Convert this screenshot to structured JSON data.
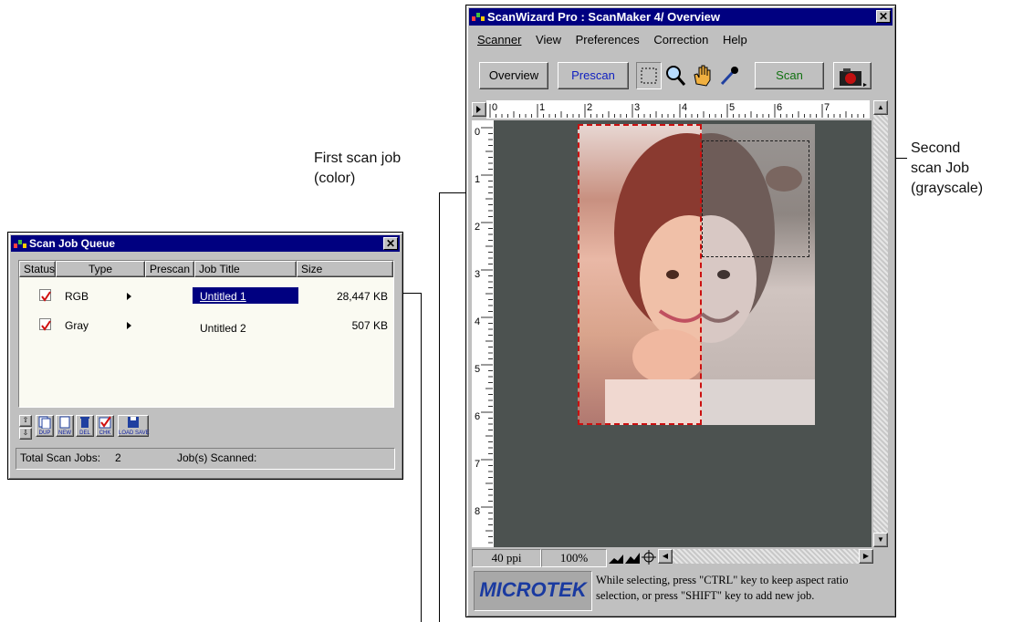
{
  "annotations": {
    "first_line1": "First scan job",
    "first_line2": "(color)",
    "second_line1": "Second",
    "second_line2": "scan Job",
    "second_line3": "(grayscale)"
  },
  "scanwizard": {
    "title": "ScanWizard Pro : ScanMaker 4/ Overview",
    "menu": [
      "Scanner",
      "View",
      "Preferences",
      "Correction",
      "Help"
    ],
    "toolbar": {
      "overview": "Overview",
      "prescan": "Prescan",
      "scan": "Scan"
    },
    "ruler_h_labels": [
      "0",
      "1",
      "2",
      "3",
      "4",
      "5",
      "6",
      "7"
    ],
    "ruler_v_labels": [
      "0",
      "1",
      "2",
      "3",
      "4",
      "5",
      "6",
      "7",
      "8"
    ],
    "resolution": "40 ppi",
    "zoom": "100%",
    "brand": "MICROTEK",
    "hint": "While selecting, press \"CTRL\" key to keep aspect ratio selection, or press \"SHIFT\" key to add new job.",
    "colors": {
      "preview_bg": "#4c5250",
      "selection": "#cc1010"
    }
  },
  "queue": {
    "title": "Scan Job Queue",
    "columns": [
      "Status",
      "Type",
      "Prescan",
      "Job Title",
      "Size"
    ],
    "rows": [
      {
        "type": "RGB",
        "title": "Untitled 1",
        "size": "28,447 KB",
        "checked": true,
        "selected": true
      },
      {
        "type": "Gray",
        "title": "Untitled 2",
        "size": "507 KB",
        "checked": true,
        "selected": false
      }
    ],
    "buttons": [
      "DUP",
      "NEW",
      "DEL",
      "CHK",
      "LOAD SAVE"
    ],
    "footer": {
      "total_label": "Total Scan Jobs:",
      "total_value": "2",
      "scanned_label": "Job(s) Scanned:"
    }
  }
}
